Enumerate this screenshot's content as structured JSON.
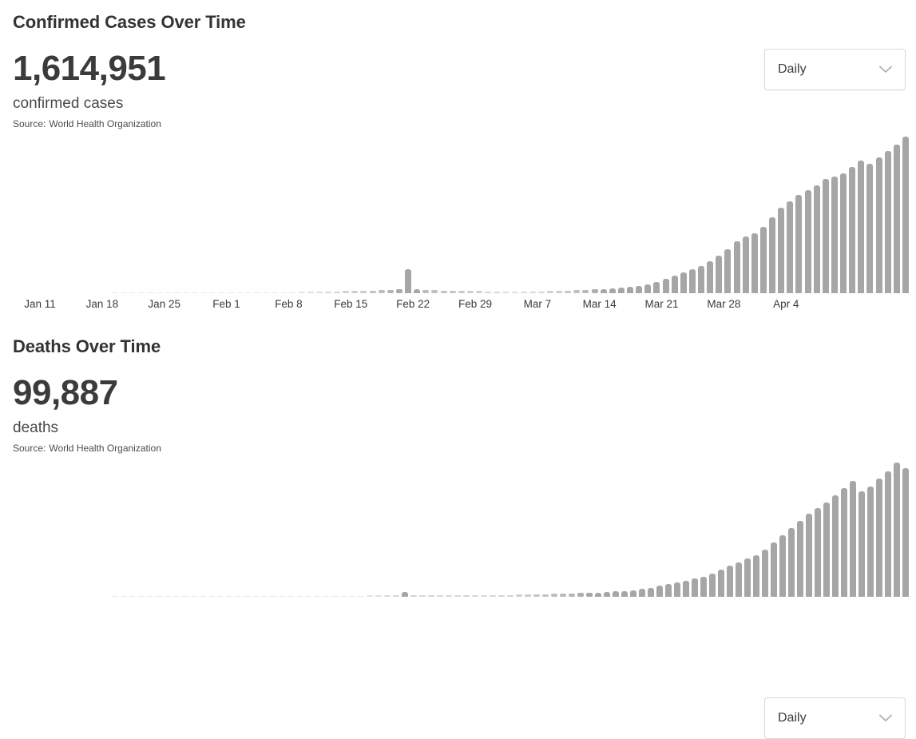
{
  "panels": [
    {
      "id": "cases",
      "title": "Confirmed Cases Over Time",
      "value": "1,614,951",
      "metric_label": "confirmed cases",
      "source_label": "Source:",
      "source_name": "World Health Organization",
      "dropdown": {
        "value": "Daily",
        "icon": "chevron-down-icon",
        "options": [
          "Daily"
        ]
      }
    },
    {
      "id": "deaths",
      "title": "Deaths Over Time",
      "value": "99,887",
      "metric_label": "deaths",
      "source_label": "Source:",
      "source_name": "World Health Organization",
      "dropdown": {
        "value": "Daily",
        "icon": "chevron-down-icon",
        "options": [
          "Daily"
        ]
      }
    }
  ],
  "colors": {
    "bar": "#a6a6a6",
    "title": "#333333",
    "text": "#3b3b3b",
    "border": "#d8d8d8",
    "background": "#ffffff"
  },
  "chart_data": [
    {
      "type": "bar",
      "title": "Confirmed Cases Over Time",
      "xlabel": "",
      "ylabel": "",
      "grid": false,
      "legend": null,
      "ylim": [
        0,
        100000
      ],
      "tick_labels": [
        "Jan 11",
        "Jan 18",
        "Jan 25",
        "Feb 1",
        "Feb 8",
        "Feb 15",
        "Feb 22",
        "Feb 29",
        "Mar 7",
        "Mar 14",
        "Mar 21",
        "Mar 28",
        "Apr 4"
      ],
      "tick_indices": [
        0,
        7,
        14,
        21,
        28,
        35,
        42,
        49,
        56,
        63,
        70,
        77,
        84
      ],
      "x": [
        "Jan 11",
        "Jan 12",
        "Jan 13",
        "Jan 14",
        "Jan 15",
        "Jan 16",
        "Jan 17",
        "Jan 18",
        "Jan 19",
        "Jan 20",
        "Jan 21",
        "Jan 22",
        "Jan 23",
        "Jan 24",
        "Jan 25",
        "Jan 26",
        "Jan 27",
        "Jan 28",
        "Jan 29",
        "Jan 30",
        "Jan 31",
        "Feb 1",
        "Feb 2",
        "Feb 3",
        "Feb 4",
        "Feb 5",
        "Feb 6",
        "Feb 7",
        "Feb 8",
        "Feb 9",
        "Feb 10",
        "Feb 11",
        "Feb 12",
        "Feb 13",
        "Feb 14",
        "Feb 15",
        "Feb 16",
        "Feb 17",
        "Feb 18",
        "Feb 19",
        "Feb 20",
        "Feb 21",
        "Feb 22",
        "Feb 23",
        "Feb 24",
        "Feb 25",
        "Feb 26",
        "Feb 27",
        "Feb 28",
        "Feb 29",
        "Mar 1",
        "Mar 2",
        "Mar 3",
        "Mar 4",
        "Mar 5",
        "Mar 6",
        "Mar 7",
        "Mar 8",
        "Mar 9",
        "Mar 10",
        "Mar 11",
        "Mar 12",
        "Mar 13",
        "Mar 14",
        "Mar 15",
        "Mar 16",
        "Mar 17",
        "Mar 18",
        "Mar 19",
        "Mar 20",
        "Mar 21",
        "Mar 22",
        "Mar 23",
        "Mar 24",
        "Mar 25",
        "Mar 26",
        "Mar 27",
        "Mar 28",
        "Mar 29",
        "Mar 30",
        "Mar 31",
        "Apr 1",
        "Apr 2",
        "Apr 3",
        "Apr 4",
        "Apr 5",
        "Apr 6",
        "Apr 7",
        "Apr 8",
        "Apr 9"
      ],
      "values": [
        0,
        0,
        0,
        0,
        0,
        0,
        0,
        0,
        0,
        0,
        0,
        0,
        0,
        0,
        100,
        200,
        300,
        400,
        500,
        600,
        700,
        800,
        900,
        1000,
        1100,
        1200,
        1300,
        1400,
        1500,
        1700,
        1900,
        2100,
        2400,
        15000,
        2600,
        1900,
        1800,
        1700,
        1600,
        1500,
        1400,
        1300,
        1200,
        1100,
        1000,
        900,
        1000,
        1100,
        1200,
        1300,
        1400,
        1600,
        1800,
        2000,
        2300,
        2600,
        3000,
        3500,
        4000,
        4800,
        5800,
        7200,
        9000,
        11000,
        13000,
        15000,
        17000,
        20000,
        24000,
        28000,
        33000,
        36000,
        38000,
        42000,
        48000,
        54000,
        58000,
        62000,
        65000,
        68000,
        72000,
        74000,
        76000,
        80000,
        84000,
        82000,
        86000,
        90000,
        94000,
        99000
      ],
      "bars_cut_off": false
    },
    {
      "type": "bar",
      "title": "Deaths Over Time",
      "xlabel": "",
      "ylabel": "",
      "grid": false,
      "legend": null,
      "ylim": [
        0,
        8000
      ],
      "tick_labels": [],
      "x": [
        "Jan 11",
        "Jan 12",
        "Jan 13",
        "Jan 14",
        "Jan 15",
        "Jan 16",
        "Jan 17",
        "Jan 18",
        "Jan 19",
        "Jan 20",
        "Jan 21",
        "Jan 22",
        "Jan 23",
        "Jan 24",
        "Jan 25",
        "Jan 26",
        "Jan 27",
        "Jan 28",
        "Jan 29",
        "Jan 30",
        "Jan 31",
        "Feb 1",
        "Feb 2",
        "Feb 3",
        "Feb 4",
        "Feb 5",
        "Feb 6",
        "Feb 7",
        "Feb 8",
        "Feb 9",
        "Feb 10",
        "Feb 11",
        "Feb 12",
        "Feb 13",
        "Feb 14",
        "Feb 15",
        "Feb 16",
        "Feb 17",
        "Feb 18",
        "Feb 19",
        "Feb 20",
        "Feb 21",
        "Feb 22",
        "Feb 23",
        "Feb 24",
        "Feb 25",
        "Feb 26",
        "Feb 27",
        "Feb 28",
        "Feb 29",
        "Mar 1",
        "Mar 2",
        "Mar 3",
        "Mar 4",
        "Mar 5",
        "Mar 6",
        "Mar 7",
        "Mar 8",
        "Mar 9",
        "Mar 10",
        "Mar 11",
        "Mar 12",
        "Mar 13",
        "Mar 14",
        "Mar 15",
        "Mar 16",
        "Mar 17",
        "Mar 18",
        "Mar 19",
        "Mar 20",
        "Mar 21",
        "Mar 22",
        "Mar 23",
        "Mar 24",
        "Mar 25",
        "Mar 26",
        "Mar 27",
        "Mar 28",
        "Mar 29",
        "Mar 30",
        "Mar 31",
        "Apr 1",
        "Apr 2",
        "Apr 3",
        "Apr 4",
        "Apr 5",
        "Apr 6",
        "Apr 7",
        "Apr 8",
        "Apr 9"
      ],
      "values": [
        0,
        0,
        0,
        0,
        0,
        0,
        0,
        0,
        0,
        0,
        0,
        0,
        0,
        0,
        5,
        8,
        10,
        12,
        15,
        18,
        20,
        25,
        30,
        35,
        40,
        45,
        50,
        55,
        60,
        70,
        80,
        90,
        100,
        250,
        110,
        100,
        105,
        100,
        95,
        100,
        110,
        100,
        95,
        100,
        105,
        110,
        120,
        130,
        140,
        150,
        160,
        170,
        180,
        200,
        220,
        240,
        260,
        290,
        320,
        360,
        420,
        500,
        600,
        700,
        800,
        900,
        1000,
        1100,
        1300,
        1500,
        1700,
        1900,
        2100,
        2300,
        2600,
        3000,
        3400,
        3800,
        4200,
        4600,
        4900,
        5200,
        5600,
        6000,
        6400,
        5800,
        6100,
        6500,
        6900,
        7400,
        7100
      ],
      "bars_cut_off": true
    }
  ]
}
